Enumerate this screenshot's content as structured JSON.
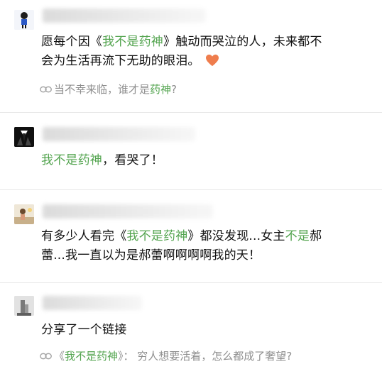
{
  "comments": [
    {
      "content_line1": "愿每个因《",
      "content_hl1": "我不是药神",
      "content_line1_b": "》触动而哭泣的人，未来都不",
      "content_line2": "会为生活再流下无助的眼泪。",
      "sub_prefix": "当不幸来临，谁才是",
      "sub_hl": "药神",
      "sub_suffix": "?"
    },
    {
      "content_hl": "我不是药神",
      "content_rest": "，看哭了！"
    },
    {
      "line1_a": "有多少人看完《",
      "line1_hl": "我不是药神",
      "line1_b": "》都没发现...女主",
      "line1_hl2": "不是",
      "line1_c": "郝",
      "line2": "蕾...我一直以为是郝蕾啊啊啊啊我的天！"
    },
    {
      "content": "分享了一个链接",
      "link_prefix": "《",
      "link_hl": "我不是药神",
      "link_rest": "》：  穷人想要活着，怎么都成了奢望?"
    }
  ],
  "colors": {
    "highlight": "#53a44f",
    "divider": "#e8e8e8",
    "subtext": "#8f8f8f"
  }
}
